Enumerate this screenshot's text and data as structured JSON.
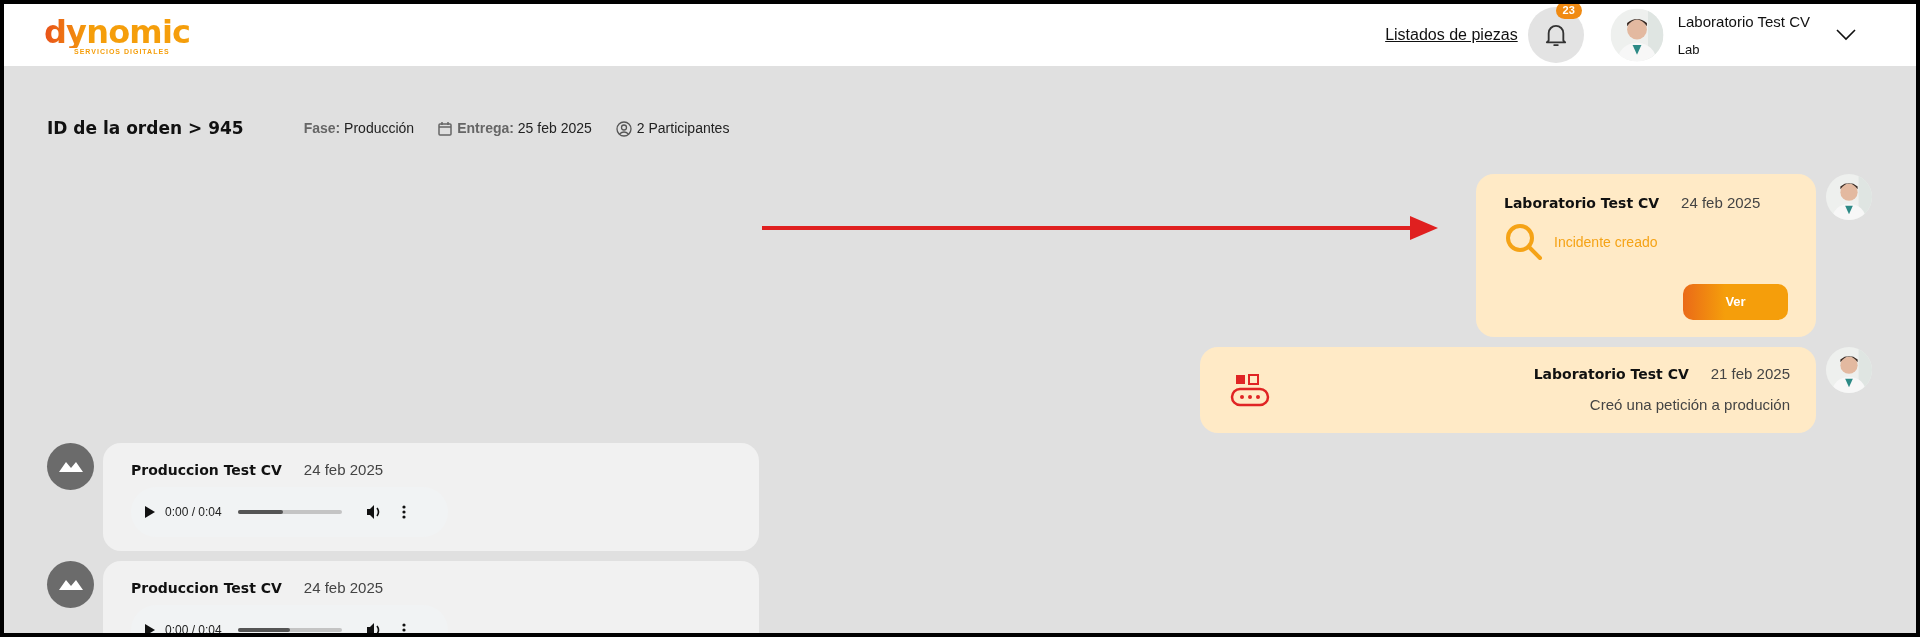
{
  "header": {
    "logo": "dynomic",
    "logo_tagline": "SERVICIOS DIGITALES",
    "link": "Listados de piezas",
    "notification_count": "23",
    "user": {
      "name": "Laboratorio Test CV",
      "role": "Lab"
    }
  },
  "order": {
    "title": "ID de la orden > 945",
    "phase_label": "Fase:",
    "phase": "Producción",
    "delivery_label": "Entrega:",
    "delivery": "25 feb 2025",
    "participants": "2 Participantes"
  },
  "messages": [
    {
      "kind": "incident",
      "author": "Laboratorio Test CV",
      "date": "24 feb 2025",
      "text": "Incidente creado",
      "button": "Ver"
    },
    {
      "kind": "request",
      "author": "Laboratorio Test CV",
      "date": "21 feb 2025",
      "text": "Creó una petición a produción"
    },
    {
      "kind": "audio",
      "author": "Produccion Test CV",
      "date": "24 feb 2025",
      "time": "0:00 / 0:04",
      "level": 0.44
    },
    {
      "kind": "audio",
      "author": "Produccion Test CV",
      "date": "24 feb 2025",
      "time": "0:00 / 0:04",
      "level": 0.5
    }
  ]
}
